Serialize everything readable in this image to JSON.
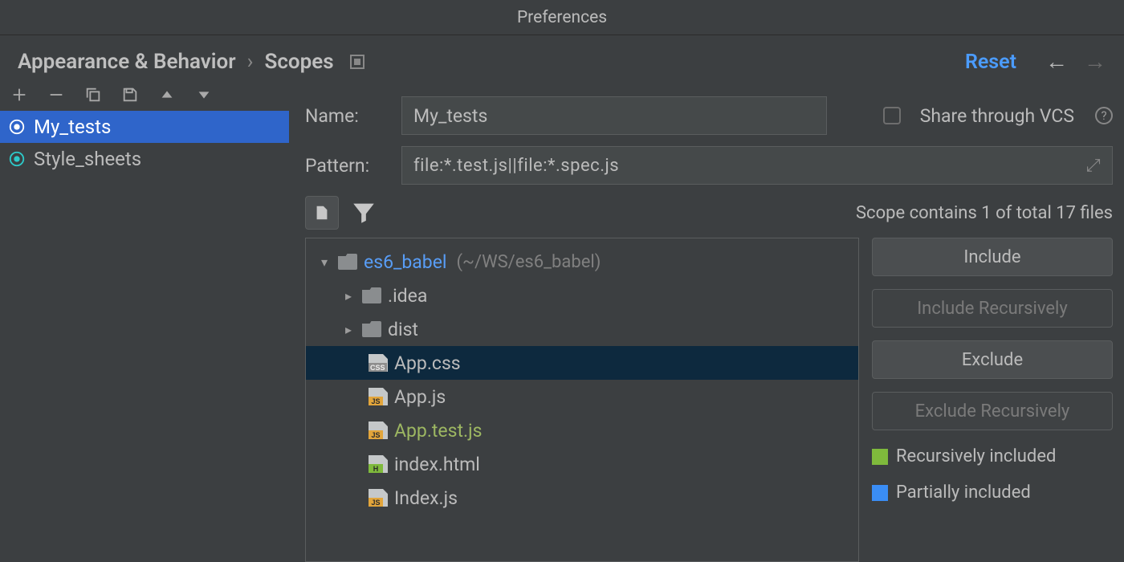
{
  "window_title": "Preferences",
  "breadcrumb": {
    "root": "Appearance & Behavior",
    "leaf": "Scopes"
  },
  "header": {
    "reset": "Reset"
  },
  "left": {
    "scopes": [
      {
        "name": "My_tests",
        "selected": true
      },
      {
        "name": "Style_sheets",
        "selected": false
      }
    ]
  },
  "form": {
    "name_label": "Name:",
    "name_value": "My_tests",
    "share_label": "Share through VCS",
    "pattern_label": "Pattern:",
    "pattern_value": "file:*.test.js||file:*.spec.js",
    "scope_count": "Scope contains 1 of total 17 files"
  },
  "buttons": {
    "include": "Include",
    "include_rec": "Include Recursively",
    "exclude": "Exclude",
    "exclude_rec": "Exclude Recursively"
  },
  "legend": {
    "rec": "Recursively included",
    "part": "Partially included"
  },
  "tree": {
    "project_name": "es6_babel",
    "project_path": "(~/WS/es6_babel)",
    "items": [
      {
        "kind": "folder",
        "name": ".idea"
      },
      {
        "kind": "folder",
        "name": "dist"
      },
      {
        "kind": "file",
        "name": "App.css",
        "ft": "css",
        "selected": true
      },
      {
        "kind": "file",
        "name": "App.js",
        "ft": "js"
      },
      {
        "kind": "file",
        "name": "App.test.js",
        "ft": "js",
        "green": true
      },
      {
        "kind": "file",
        "name": "index.html",
        "ft": "h"
      },
      {
        "kind": "file",
        "name": "Index.js",
        "ft": "js"
      }
    ]
  }
}
